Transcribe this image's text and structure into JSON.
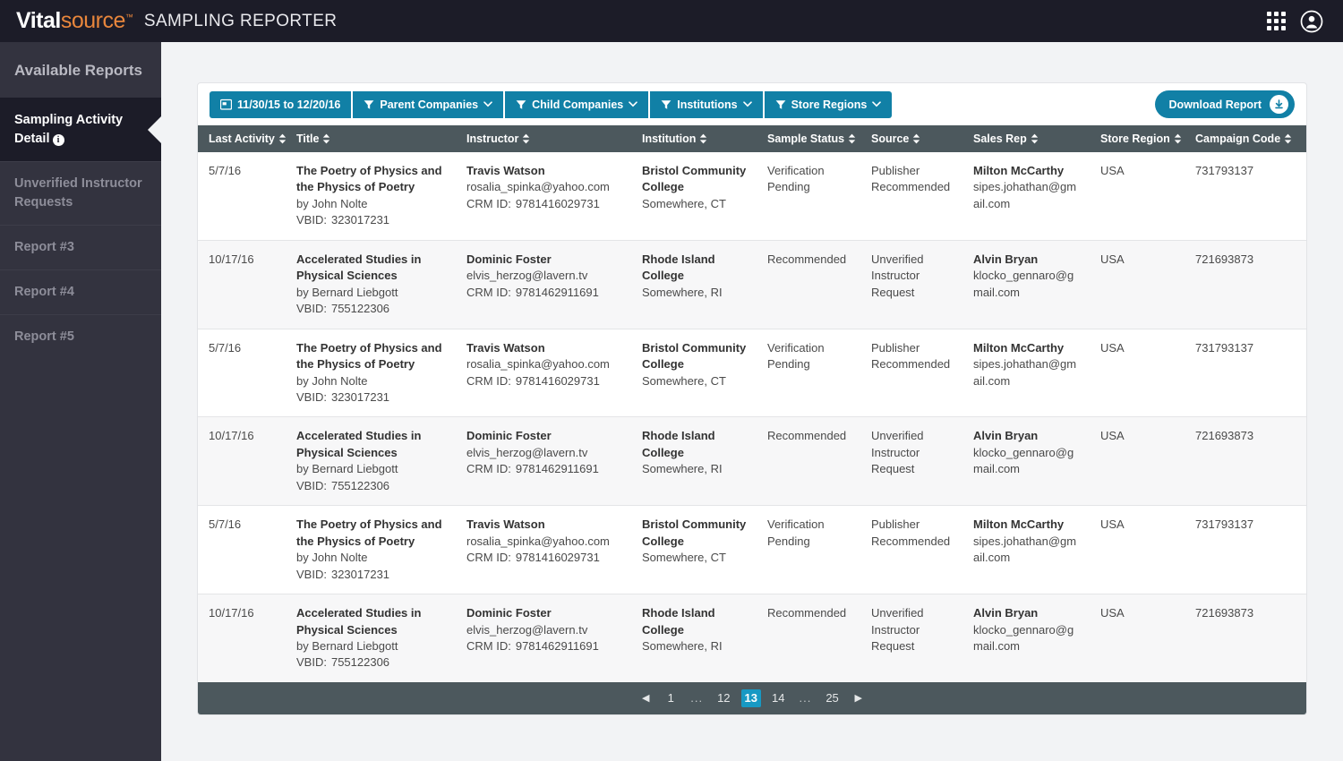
{
  "topbar": {
    "logo_primary": "Vital",
    "logo_secondary": "source",
    "logo_tm": "™",
    "app_title": "SAMPLING REPORTER",
    "apps_icon": "grid-apps-icon",
    "account_icon": "user-account-icon"
  },
  "sidebar": {
    "title": "Available Reports",
    "items": [
      {
        "label": "Sampling Activity Detail",
        "active": true,
        "has_info_icon": true,
        "info_glyph": "i"
      },
      {
        "label": "Unverified Instructor Requests",
        "active": false,
        "has_info_icon": false
      },
      {
        "label": "Report #3",
        "active": false,
        "has_info_icon": false
      },
      {
        "label": "Report #4",
        "active": false,
        "has_info_icon": false
      },
      {
        "label": "Report #5",
        "active": false,
        "has_info_icon": false
      }
    ]
  },
  "toolbar": {
    "date_range": "11/30/15 to 12/20/16",
    "calendar_icon": "calendar-icon",
    "filters": [
      {
        "label": "Parent Companies",
        "icon": "funnel-icon"
      },
      {
        "label": "Child Companies",
        "icon": "funnel-icon"
      },
      {
        "label": "Institutions",
        "icon": "funnel-icon"
      },
      {
        "label": "Store Regions",
        "icon": "funnel-icon"
      }
    ],
    "download_label": "Download Report",
    "download_icon": "download-arrow-icon",
    "accent_color": "#1180a6"
  },
  "table": {
    "header_color": "#4c585d",
    "columns": [
      {
        "key": "last_activity",
        "label": "Last Activity"
      },
      {
        "key": "title",
        "label": "Title"
      },
      {
        "key": "instructor",
        "label": "Instructor"
      },
      {
        "key": "institution",
        "label": "Institution"
      },
      {
        "key": "sample_status",
        "label": "Sample Status"
      },
      {
        "key": "source",
        "label": "Source"
      },
      {
        "key": "sales_rep",
        "label": "Sales Rep"
      },
      {
        "key": "store_region",
        "label": "Store Region"
      },
      {
        "key": "campaign_code",
        "label": "Campaign Code"
      }
    ],
    "labels": {
      "by_prefix": "by",
      "vbid": "VBID:",
      "crm_id": "CRM ID:"
    },
    "rows": [
      {
        "last_activity": "5/7/16",
        "title": "The Poetry of Physics and the Physics of Poetry",
        "author": "by John Nolte",
        "vbid": "323017231",
        "instructor_name": "Travis Watson",
        "instructor_email": "rosalia_spinka@yahoo.com",
        "crm_id": "9781416029731",
        "institution_name": "Bristol Community College",
        "institution_location": "Somewhere, CT",
        "sample_status": "Verification Pending",
        "source": "Publisher Recommended",
        "sales_rep_name": "Milton McCarthy",
        "sales_rep_email": "sipes.johathan@gmail.com",
        "store_region": "USA",
        "campaign_code": "731793137"
      },
      {
        "last_activity": "10/17/16",
        "title": "Accelerated Studies in Physical Sciences",
        "author": "by Bernard Liebgott",
        "vbid": "755122306",
        "instructor_name": "Dominic Foster",
        "instructor_email": "elvis_herzog@lavern.tv",
        "crm_id": "9781462911691",
        "institution_name": "Rhode Island College",
        "institution_location": "Somewhere, RI",
        "sample_status": "Recommended",
        "source": "Unverified Instructor Request",
        "sales_rep_name": "Alvin Bryan",
        "sales_rep_email": "klocko_gennaro@gmail.com",
        "store_region": "USA",
        "campaign_code": "721693873"
      },
      {
        "last_activity": "5/7/16",
        "title": "The Poetry of Physics and the Physics of Poetry",
        "author": "by John Nolte",
        "vbid": "323017231",
        "instructor_name": "Travis Watson",
        "instructor_email": "rosalia_spinka@yahoo.com",
        "crm_id": "9781416029731",
        "institution_name": "Bristol Community College",
        "institution_location": "Somewhere, CT",
        "sample_status": "Verification Pending",
        "source": "Publisher Recommended",
        "sales_rep_name": "Milton McCarthy",
        "sales_rep_email": "sipes.johathan@gmail.com",
        "store_region": "USA",
        "campaign_code": "731793137"
      },
      {
        "last_activity": "10/17/16",
        "title": "Accelerated Studies in Physical Sciences",
        "author": "by Bernard Liebgott",
        "vbid": "755122306",
        "instructor_name": "Dominic Foster",
        "instructor_email": "elvis_herzog@lavern.tv",
        "crm_id": "9781462911691",
        "institution_name": "Rhode Island College",
        "institution_location": "Somewhere, RI",
        "sample_status": "Recommended",
        "source": "Unverified Instructor Request",
        "sales_rep_name": "Alvin Bryan",
        "sales_rep_email": "klocko_gennaro@gmail.com",
        "store_region": "USA",
        "campaign_code": "721693873"
      },
      {
        "last_activity": "5/7/16",
        "title": "The Poetry of Physics and the Physics of Poetry",
        "author": "by John Nolte",
        "vbid": "323017231",
        "instructor_name": "Travis Watson",
        "instructor_email": "rosalia_spinka@yahoo.com",
        "crm_id": "9781416029731",
        "institution_name": "Bristol Community College",
        "institution_location": "Somewhere, CT",
        "sample_status": "Verification Pending",
        "source": "Publisher Recommended",
        "sales_rep_name": "Milton McCarthy",
        "sales_rep_email": "sipes.johathan@gmail.com",
        "store_region": "USA",
        "campaign_code": "731793137"
      },
      {
        "last_activity": "10/17/16",
        "title": "Accelerated Studies in Physical Sciences",
        "author": "by Bernard Liebgott",
        "vbid": "755122306",
        "instructor_name": "Dominic Foster",
        "instructor_email": "elvis_herzog@lavern.tv",
        "crm_id": "9781462911691",
        "institution_name": "Rhode Island College",
        "institution_location": "Somewhere, RI",
        "sample_status": "Recommended",
        "source": "Unverified Instructor Request",
        "sales_rep_name": "Alvin Bryan",
        "sales_rep_email": "klocko_gennaro@gmail.com",
        "store_region": "USA",
        "campaign_code": "721693873"
      }
    ]
  },
  "pagination": {
    "prev_glyph": "◀",
    "next_glyph": "▶",
    "items": [
      {
        "label": "1",
        "type": "page"
      },
      {
        "label": "...",
        "type": "ellipsis"
      },
      {
        "label": "12",
        "type": "page"
      },
      {
        "label": "13",
        "type": "page",
        "active": true
      },
      {
        "label": "14",
        "type": "page"
      },
      {
        "label": "...",
        "type": "ellipsis"
      },
      {
        "label": "25",
        "type": "page"
      }
    ],
    "active_color": "#1799c4"
  }
}
